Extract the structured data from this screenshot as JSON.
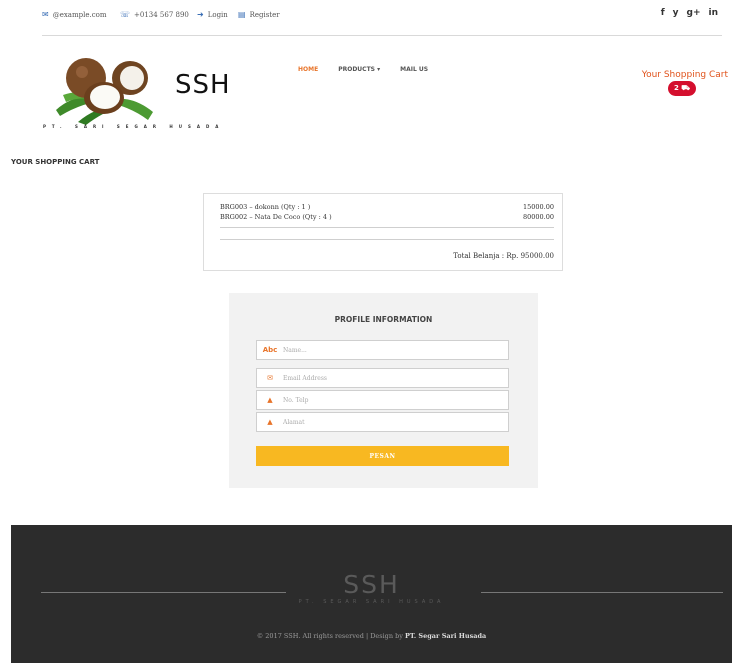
{
  "topbar": {
    "email": "@example.com",
    "phone": "+0134 567 890",
    "login": "Login",
    "register": "Register",
    "social": [
      "f",
      "y",
      "g+",
      "in"
    ]
  },
  "header": {
    "brand": "SSH",
    "brand_sub": "PT. SARI SEGAR HUSADA",
    "nav": [
      "HOME",
      "PRODUCTS ▾",
      "MAIL US"
    ],
    "cart_label": "Your Shopping Cart",
    "cart_count": "2 ⛟"
  },
  "page": {
    "heading": "YOUR SHOPPING CART"
  },
  "cart": {
    "items": [
      {
        "label": "BRG003 – dokonn (Qty : 1 )",
        "price": "15000.00"
      },
      {
        "label": "BRG002 – Nata De Coco (Qty : 4 )",
        "price": "80000.00"
      }
    ],
    "total": "Total Belanja : Rp. 95000.00"
  },
  "profile": {
    "title": "PROFILE INFORMATION",
    "fields": [
      {
        "icon": "Abc",
        "placeholder": "Name..."
      },
      {
        "icon": "✉",
        "placeholder": "Email Address"
      },
      {
        "icon": "▲",
        "placeholder": "No. Telp"
      },
      {
        "icon": "▲",
        "placeholder": "Alamat"
      }
    ],
    "submit": "PESAN"
  },
  "footer": {
    "brand": "SSH",
    "brand_sub": "PT. SEGAR SARI HUSADA",
    "copyright": "© 2017 SSH. All rights reserved | Design by",
    "designer": "PT. Segar Sari Husada"
  },
  "colors": {
    "accent": "#e8742a",
    "badge": "#d40f2e",
    "button": "#f8b821",
    "footer_bg": "#2c2c2c"
  }
}
